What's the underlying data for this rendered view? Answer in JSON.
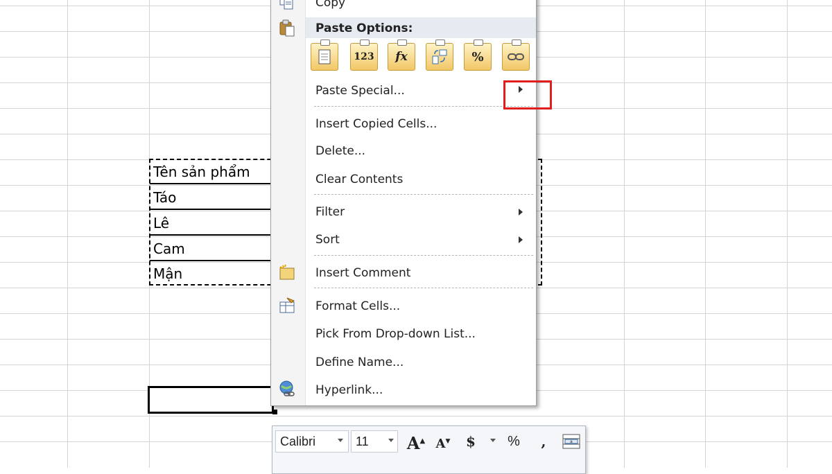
{
  "sheet": {
    "cells": [
      "Tên sản phẩm",
      "Táo",
      "Lê",
      "Cam",
      "Mận"
    ]
  },
  "context_menu": {
    "copy_label": "Copy",
    "paste_options_label": "Paste Options:",
    "paste_buttons": [
      {
        "icon": "paste-icon",
        "glyph": ""
      },
      {
        "icon": "paste-values-icon",
        "glyph": "123"
      },
      {
        "icon": "paste-formulas-icon",
        "glyph": "fx"
      },
      {
        "icon": "paste-transpose-icon",
        "glyph": ""
      },
      {
        "icon": "paste-formatting-icon",
        "glyph": "%"
      },
      {
        "icon": "paste-link-icon",
        "glyph": ""
      }
    ],
    "paste_special_label": "Paste Special...",
    "insert_copied_cells_label": "Insert Copied Cells...",
    "delete_label": "Delete...",
    "clear_contents_label": "Clear Contents",
    "filter_label": "Filter",
    "sort_label": "Sort",
    "insert_comment_label": "Insert Comment",
    "format_cells_label": "Format Cells...",
    "pick_from_list_label": "Pick From Drop-down List...",
    "define_name_label": "Define Name...",
    "hyperlink_label": "Hyperlink..."
  },
  "mini_toolbar": {
    "font_name": "Calibri",
    "font_size": "11",
    "grow_font": "A",
    "shrink_font": "A",
    "currency": "$",
    "percent": "%",
    "comma": ","
  },
  "colors": {
    "highlight": "#e11d1d",
    "menu_hover": "#e6ebf2",
    "grid": "#d4d4d4"
  }
}
